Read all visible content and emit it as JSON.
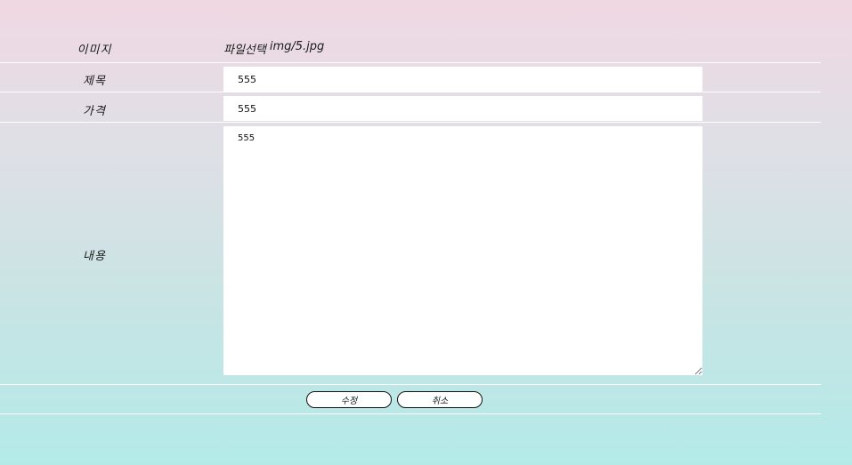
{
  "form": {
    "image": {
      "label": "이미지",
      "file_button_label": "파일선택",
      "file_name": "img/5.jpg"
    },
    "title": {
      "label": "제목",
      "value": "555"
    },
    "price": {
      "label": "가격",
      "value": "555"
    },
    "content": {
      "label": "내용",
      "value": "555"
    },
    "buttons": {
      "submit_label": "수정",
      "cancel_label": "취소"
    }
  }
}
